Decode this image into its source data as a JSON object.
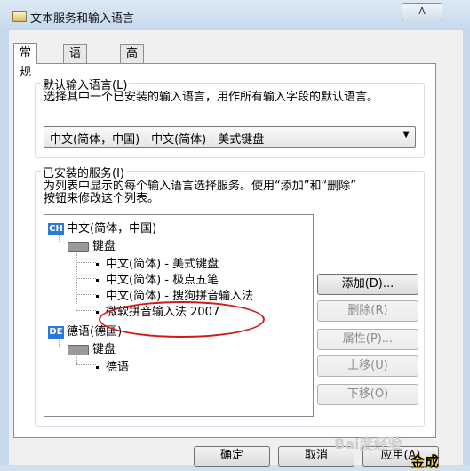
{
  "window": {
    "title": "文本服务和输入语言",
    "close_label": "ᐱ"
  },
  "tabs": [
    {
      "label": "常规",
      "active": true
    },
    {
      "label": "语言栏",
      "active": false
    },
    {
      "label": "高级键设置",
      "active": false
    }
  ],
  "default_lang": {
    "group_label": "默认输入语言(L)",
    "description": "选择其中一个已安装的输入语言，用作所有输入字段的默认语言。",
    "selected": "中文(简体，中国) - 中文(简体) - 美式键盘",
    "arrow": "▼"
  },
  "installed": {
    "group_label": "已安装的服务(I)",
    "description_line1": "为列表中显示的每个输入语言选择服务。使用“添加”和“删除”",
    "description_line2": "按钮来修改这个列表。",
    "tree": {
      "lang1": {
        "badge": "CH",
        "label": "中文(简体，中国)"
      },
      "lang1_keyboard": "键盘",
      "lang1_items": [
        "中文(简体) - 美式键盘",
        "中文(简体) - 极点五笔",
        "中文(简体) - 搜狗拼音输入法",
        "微软拼音输入法 2007"
      ],
      "lang2": {
        "badge": "DE",
        "label": "德语(德国)"
      },
      "lang2_keyboard": "键盘",
      "lang2_items": [
        "德语"
      ]
    }
  },
  "buttons": {
    "add": "添加(D)...",
    "remove": "删除(R)",
    "properties": "属性(P)...",
    "move_up": "上移(U)",
    "move_down": "下移(O)"
  },
  "footer": {
    "ok": "确定",
    "cancel": "取消",
    "apply": "应用(A)"
  },
  "watermark": "Bai度经验",
  "corner_text": "金成"
}
